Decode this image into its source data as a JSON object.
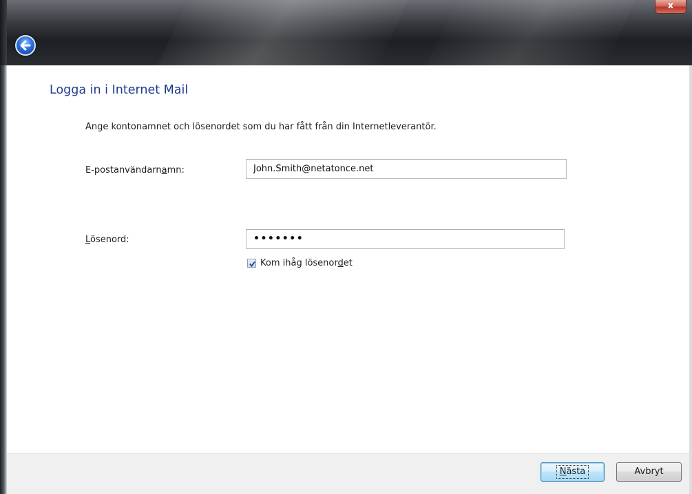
{
  "window": {
    "close_label": "x",
    "back_label": "Back"
  },
  "page": {
    "heading": "Logga in i Internet Mail",
    "instruction": "Ange kontonamnet och lösenordet som du har fått från din Internetleverantör."
  },
  "form": {
    "username": {
      "label_pre": "E-postanvändarn",
      "label_accel": "a",
      "label_post": "mn:",
      "value": "John.Smith@netatonce.net"
    },
    "password": {
      "label_accel": "L",
      "label_post": "ösenord:",
      "value": "•••••••"
    },
    "remember": {
      "label_pre": "Kom ihåg lösenor",
      "label_accel": "d",
      "label_post": "et",
      "checked": true
    }
  },
  "footer": {
    "next_label_accel": "N",
    "next_label_post": "ästa",
    "cancel_label": "Avbryt"
  }
}
